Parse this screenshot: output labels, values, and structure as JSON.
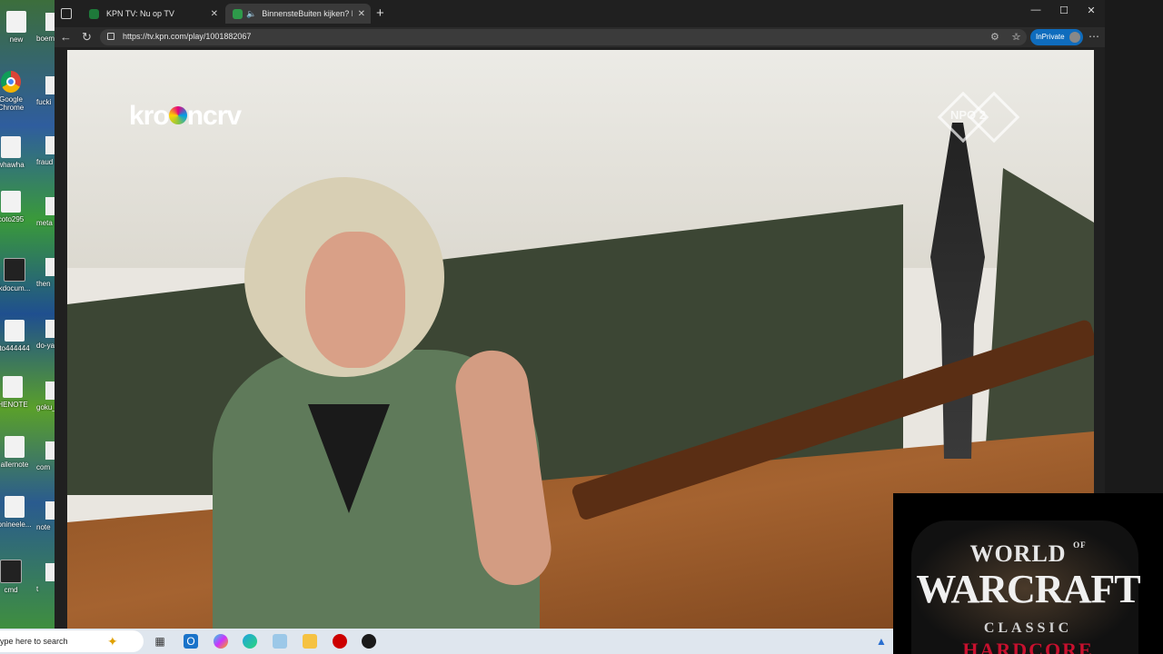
{
  "desktop": {
    "icons_left": [
      {
        "label": "new",
        "kind": "doc"
      },
      {
        "label": "Google Chrome",
        "kind": "chrome"
      },
      {
        "label": "whawha",
        "kind": "doc"
      },
      {
        "label": "coto295",
        "kind": "doc"
      },
      {
        "label": "kdocum...",
        "kind": "dark"
      },
      {
        "label": "to444444",
        "kind": "doc"
      },
      {
        "label": "HENOTE",
        "kind": "doc"
      },
      {
        "label": "allernote",
        "kind": "doc"
      },
      {
        "label": "onineele...",
        "kind": "doc"
      },
      {
        "label": "cmd",
        "kind": "dark"
      }
    ],
    "icons_right": [
      "boem",
      "fucki",
      "fraud",
      "meta",
      "then",
      "do-ya",
      "goku_",
      "com",
      "note",
      "t"
    ]
  },
  "browser": {
    "tabs": [
      {
        "title": "KPN TV: Nu op TV",
        "active": false
      },
      {
        "title": "BinnensteBuiten kijken? Dat",
        "active": true
      }
    ],
    "new_tab": "+",
    "controls": {
      "minimize": "—",
      "maximize": "☐",
      "close": "✕"
    },
    "back": "←",
    "reload": "↻",
    "url": "https://tv.kpn.com/play/1001882067",
    "inprivate_label": "InPrivate",
    "more": "⋯"
  },
  "video": {
    "broadcaster_logo": {
      "left": "kro",
      "right": "ncrv"
    },
    "channel_logo": "NPO 2"
  },
  "overlay": {
    "world": "WORLD",
    "of": "OF",
    "warcraft": "WARCRAFT",
    "classic": "CLASSIC",
    "hardcore": "HARDCORE"
  },
  "taskbar": {
    "search_text": "ype here to search",
    "apps": [
      "task-view",
      "outlook",
      "copilot",
      "edge",
      "photos",
      "file-explorer",
      "media-app",
      "game-app"
    ]
  }
}
